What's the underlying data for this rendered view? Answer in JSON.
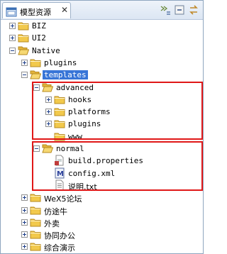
{
  "view": {
    "title": "模型资源",
    "close_glyph": "✕",
    "toolbar": [
      "collapse-all-icon",
      "link-editor-icon",
      "sync-icon"
    ]
  },
  "tree": [
    {
      "label": "BIZ",
      "icon": "folder-icon",
      "state": "collapsed",
      "level": 0
    },
    {
      "label": "UI2",
      "icon": "folder-icon",
      "state": "collapsed",
      "level": 0
    },
    {
      "label": "Native",
      "icon": "folder-open-icon",
      "state": "expanded",
      "level": 0
    },
    {
      "label": "plugins",
      "icon": "folder-icon",
      "state": "collapsed",
      "level": 1
    },
    {
      "label": "templates",
      "icon": "folder-open-icon",
      "state": "expanded",
      "level": 1,
      "selected": true
    },
    {
      "label": "advanced",
      "icon": "folder-open-icon",
      "state": "expanded",
      "level": 2
    },
    {
      "label": "hooks",
      "icon": "folder-icon",
      "state": "collapsed",
      "level": 3
    },
    {
      "label": "platforms",
      "icon": "folder-icon",
      "state": "collapsed",
      "level": 3
    },
    {
      "label": "plugins",
      "icon": "folder-icon",
      "state": "collapsed",
      "level": 3
    },
    {
      "label": "www",
      "icon": "folder-icon",
      "state": "leaf",
      "level": 3
    },
    {
      "label": "normal",
      "icon": "folder-open-icon",
      "state": "expanded",
      "level": 2
    },
    {
      "label": "build.properties",
      "icon": "properties-file-icon",
      "state": "leaf",
      "level": 3
    },
    {
      "label": "config.xml",
      "icon": "xml-file-icon",
      "state": "leaf",
      "level": 3
    },
    {
      "label": "说明.txt",
      "icon": "text-file-icon",
      "state": "leaf",
      "level": 3
    },
    {
      "label": "WeX5论坛",
      "icon": "folder-icon",
      "state": "collapsed",
      "level": 1
    },
    {
      "label": "仿途牛",
      "icon": "folder-icon",
      "state": "collapsed",
      "level": 1
    },
    {
      "label": "外卖",
      "icon": "folder-icon",
      "state": "collapsed",
      "level": 1
    },
    {
      "label": "协同办公",
      "icon": "folder-icon",
      "state": "collapsed",
      "level": 1
    },
    {
      "label": "综合演示",
      "icon": "folder-icon",
      "state": "collapsed",
      "level": 1
    }
  ],
  "highlight_color": "#e01818",
  "selection_color": "#3875d7"
}
